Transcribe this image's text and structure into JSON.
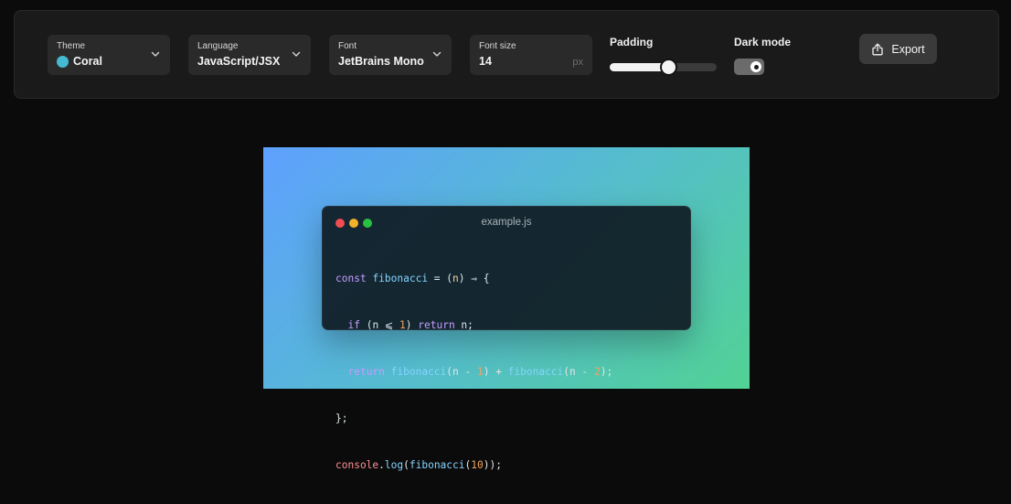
{
  "toolbar": {
    "theme": {
      "label": "Theme",
      "value": "Coral",
      "swatch_color": "#44b9d1"
    },
    "language": {
      "label": "Language",
      "value": "JavaScript/JSX"
    },
    "font": {
      "label": "Font",
      "value": "JetBrains Mono"
    },
    "font_size": {
      "label": "Font size",
      "value": "14",
      "unit": "px"
    },
    "padding": {
      "label": "Padding",
      "value_fraction": 0.55
    },
    "dark_mode": {
      "label": "Dark mode",
      "enabled": true
    },
    "export_label": "Export"
  },
  "preview": {
    "filename": "example.js",
    "window_dots": [
      "#ef4d52",
      "#f3b12a",
      "#27c340"
    ],
    "background_gradient": [
      "#5ea0ff",
      "#51d294"
    ],
    "code": {
      "l1": {
        "t1": "const",
        "t2": " ",
        "t3": "fibonacci",
        "t4": " = (",
        "t5": "n",
        "t6": ") ⇒ {"
      },
      "l2": {
        "t1": "  ",
        "t2": "if",
        "t3": " (n ⩽ ",
        "t4": "1",
        "t5": ") ",
        "t6": "return",
        "t7": " n;"
      },
      "l3": {
        "t1": "  ",
        "t2": "return",
        "t3": " ",
        "t4": "fibonacci",
        "t5": "(n - ",
        "t6": "1",
        "t7": ") + ",
        "t8": "fibonacci",
        "t9": "(n - ",
        "t10": "2",
        "t11": ");"
      },
      "l4": {
        "t1": "};"
      },
      "l5": {
        "t1": "console",
        "t2": ".",
        "t3": "log",
        "t4": "(",
        "t5": "fibonacci",
        "t6": "(",
        "t7": "10",
        "t8": "));"
      }
    }
  }
}
